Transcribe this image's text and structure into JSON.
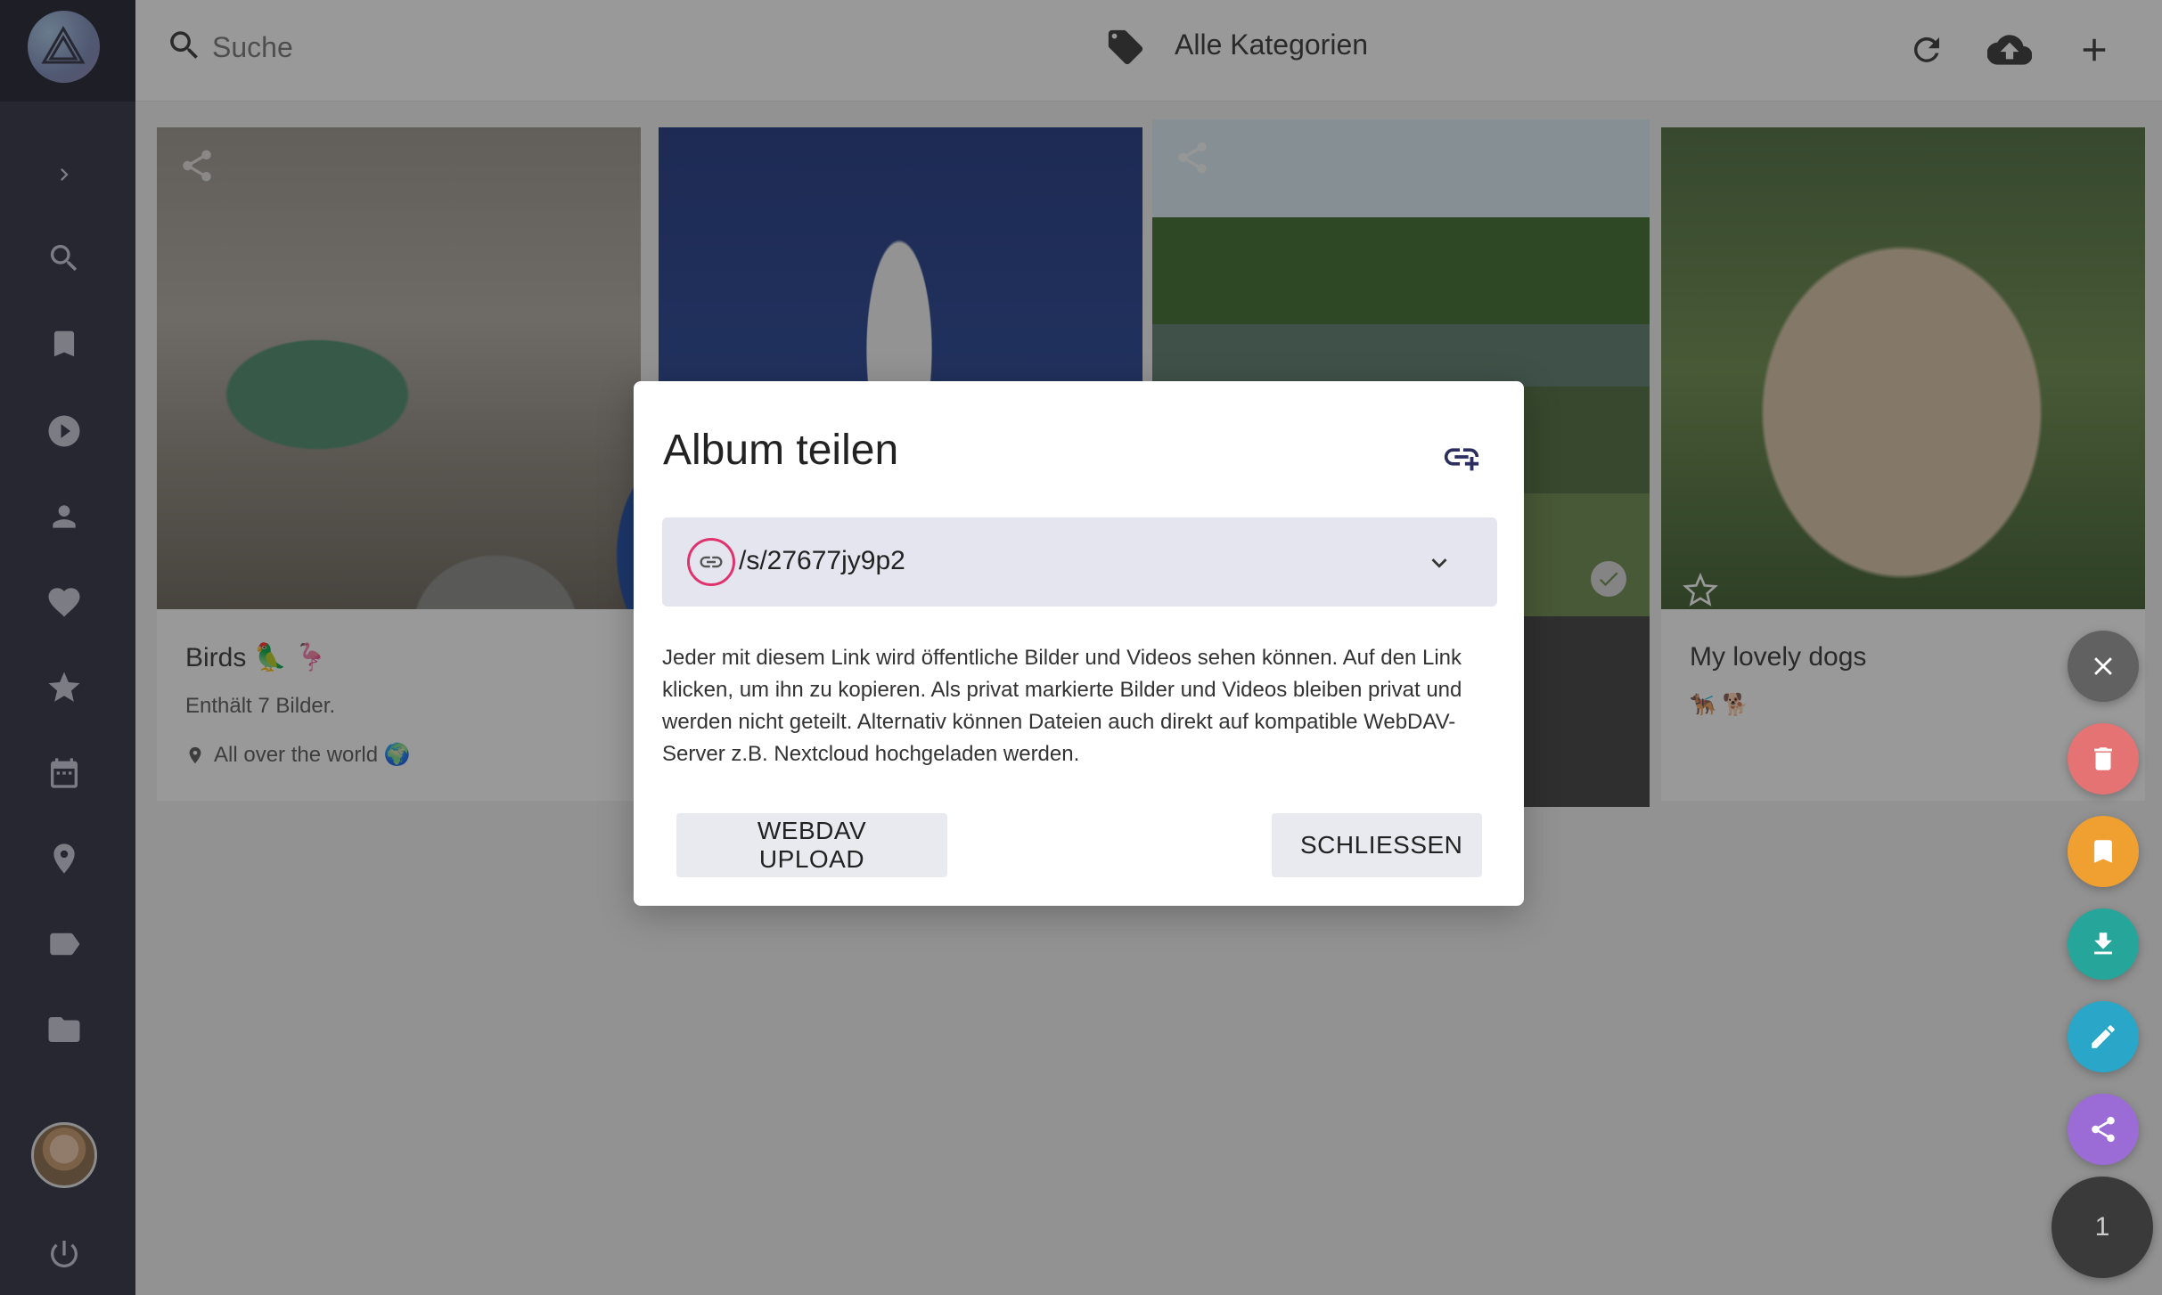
{
  "topbar": {
    "search_placeholder": "Suche",
    "category_label": "Alle Kategorien"
  },
  "sidebar": {
    "items": [
      {
        "icon": "chevron-right-icon"
      },
      {
        "icon": "search-icon"
      },
      {
        "icon": "bookmark-icon"
      },
      {
        "icon": "play-icon"
      },
      {
        "icon": "person-icon"
      },
      {
        "icon": "heart-icon"
      },
      {
        "icon": "star-icon"
      },
      {
        "icon": "calendar-icon"
      },
      {
        "icon": "location-pin-icon"
      },
      {
        "icon": "label-icon"
      },
      {
        "icon": "folder-icon"
      }
    ]
  },
  "albums": [
    {
      "title": "Birds 🦜 🦩",
      "description": "Enthält 7 Bilder.",
      "location": "All over the world 🌍"
    },
    {
      "title": "",
      "description": "",
      "location": ""
    },
    {
      "title": "",
      "description": "",
      "location": ""
    },
    {
      "title": "My lovely dogs",
      "description": "🐕‍🦺 🐕",
      "location": ""
    }
  ],
  "dialog": {
    "title": "Album teilen",
    "link_value": "/s/27677jy9p2",
    "text": "Jeder mit diesem Link wird öffentliche Bilder und Videos sehen können. Auf den Link klicken, um ihn zu kopieren. Als privat markierte Bilder und Videos bleiben privat und werden nicht geteilt. Alternativ können Dateien auch direkt auf kompatible WebDAV-Server z.B. Nextcloud hochgeladen werden.",
    "webdav_button": "WEBDAV UPLOAD",
    "close_button": "SCHLIESSEN"
  },
  "fabs": {
    "selection_count": "1",
    "colors": {
      "close": "#616161",
      "delete": "#e57373",
      "bookmark": "#f0a030",
      "download": "#26a69a",
      "edit": "#29a6c8",
      "share": "#9b6cd6"
    }
  },
  "colors": {
    "sidebar": "#2b2e3f",
    "highlight_ring": "#e0336e",
    "link_field": "#e4e5ee"
  }
}
